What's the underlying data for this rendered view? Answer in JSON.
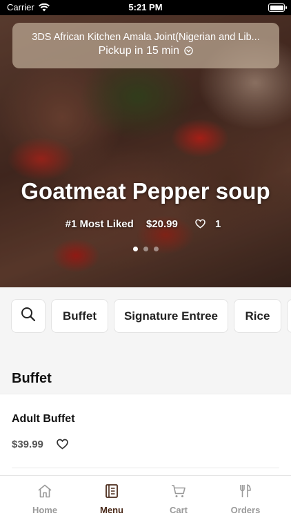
{
  "status_bar": {
    "carrier": "Carrier",
    "time": "5:21 PM"
  },
  "restaurant": {
    "name": "3DS African Kitchen Amala Joint(Nigerian and Lib...",
    "pickup": "Pickup in 15 min"
  },
  "featured": {
    "title": "Goatmeat Pepper soup",
    "badge": "#1 Most Liked",
    "price": "$20.99",
    "likes": "1",
    "carousel_pages": 3,
    "carousel_active": 1
  },
  "categories": [
    "Buffet",
    "Signature Entree",
    "Rice",
    ""
  ],
  "section": {
    "title": "Buffet"
  },
  "items": [
    {
      "name": "Adult Buffet",
      "price": "$39.99"
    }
  ],
  "tabs": [
    {
      "label": "Home",
      "icon": "home-icon",
      "active": false
    },
    {
      "label": "Menu",
      "icon": "menu-book-icon",
      "active": true
    },
    {
      "label": "Cart",
      "icon": "cart-icon",
      "active": false
    },
    {
      "label": "Orders",
      "icon": "fork-knife-icon",
      "active": false
    }
  ],
  "colors": {
    "accent": "#4a2a1a",
    "inactive_tab": "#9a9a9a",
    "background": "#f5f5f5"
  }
}
